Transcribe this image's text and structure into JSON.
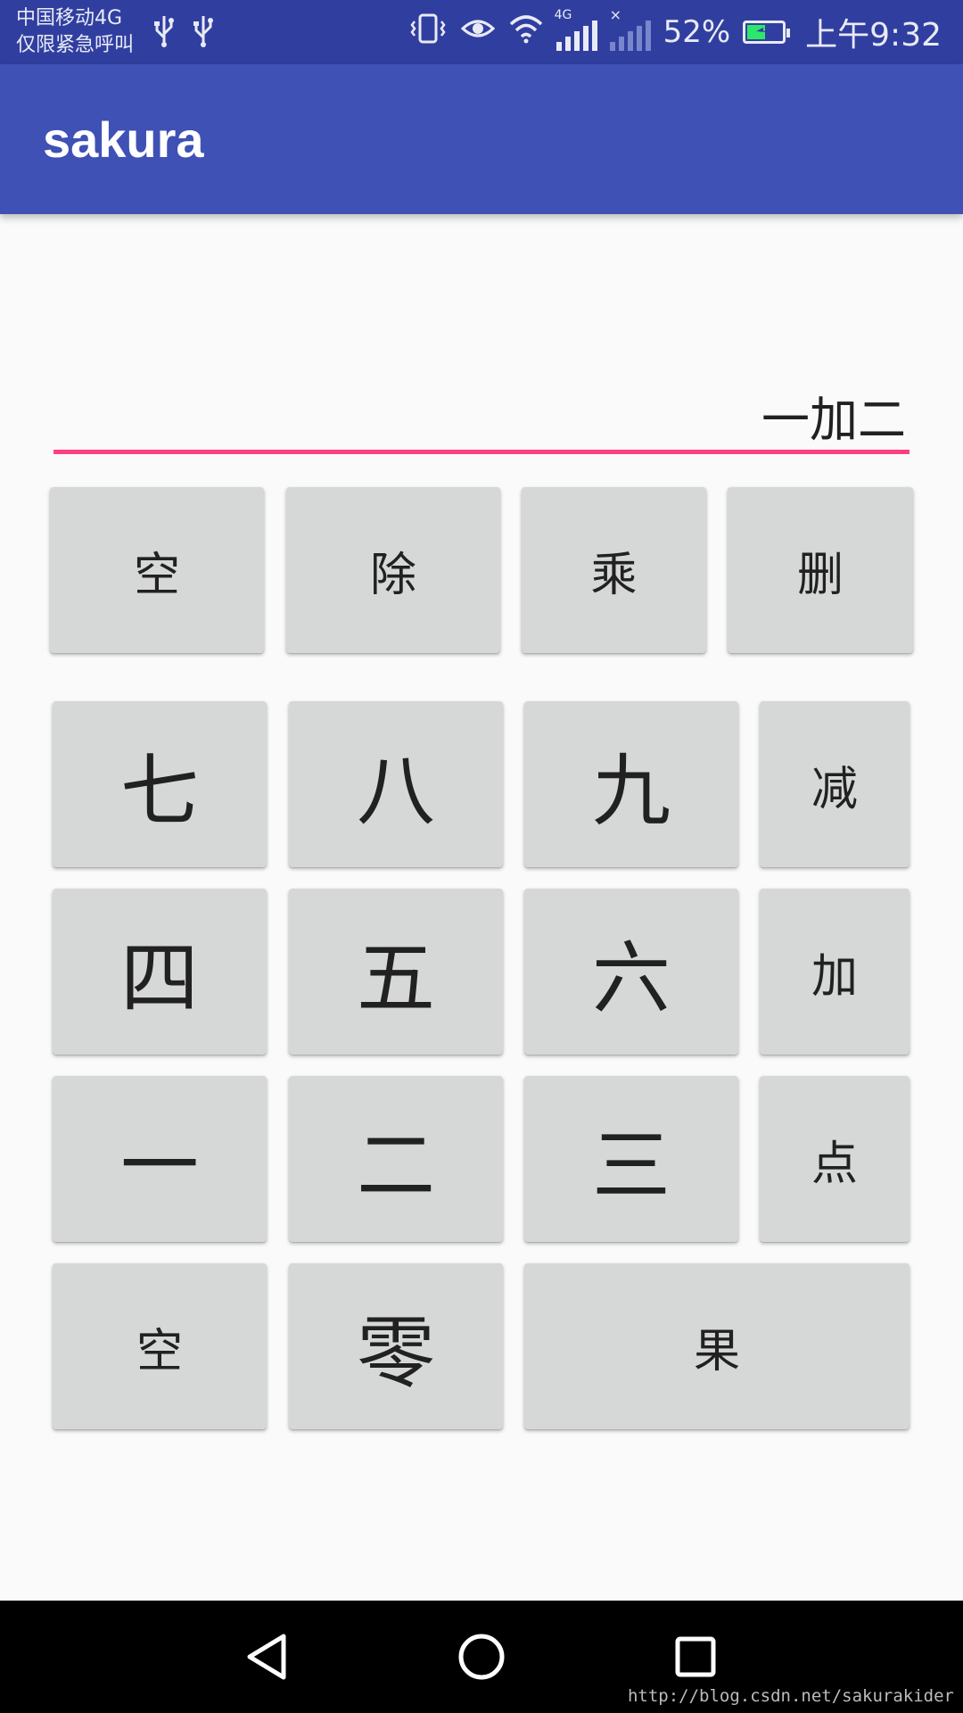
{
  "status_bar": {
    "carrier_line1": "中国移动4G",
    "carrier_line2": "仅限紧急呼叫",
    "network_type": "4G",
    "battery_percent": "52%",
    "battery_level": 0.52,
    "time": "上午9:32",
    "icons": [
      "usb-icon",
      "usb-icon",
      "vibrate-icon",
      "eye-icon",
      "wifi-icon",
      "signal-icon",
      "signal-no-sim-icon",
      "battery-charging-icon"
    ]
  },
  "app_bar": {
    "title": "sakura"
  },
  "display": {
    "value": "一加二"
  },
  "keypad": {
    "row1": [
      "空",
      "除",
      "乘",
      "删"
    ],
    "row2": [
      "七",
      "八",
      "九",
      "减"
    ],
    "row3": [
      "四",
      "五",
      "六",
      "加"
    ],
    "row4": [
      "一",
      "二",
      "三",
      "点"
    ],
    "row5": [
      "空",
      "零",
      "果"
    ]
  },
  "nav_bar": {
    "icons": [
      "back-icon",
      "home-icon",
      "recents-icon"
    ]
  },
  "watermark": "http://blog.csdn.net/sakurakider",
  "colors": {
    "status_bar": "#303f9f",
    "app_bar": "#3f51b5",
    "accent": "#ff4081",
    "button": "#d6d7d7",
    "background": "#fafafa"
  }
}
